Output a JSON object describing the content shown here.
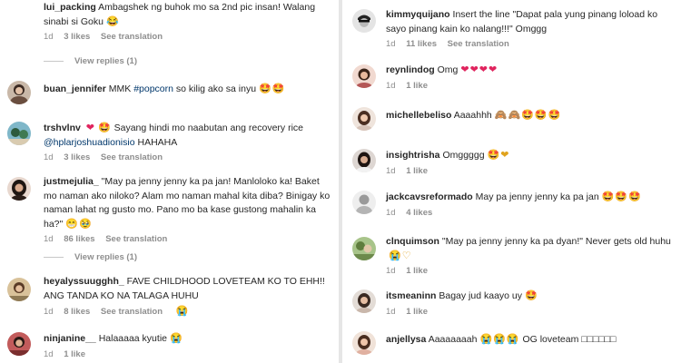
{
  "left": {
    "c1": {
      "username": "lui_packing",
      "text": "Ambagshek ng buhok mo sa 2nd pic insan! Walang sinabi si Goku",
      "emoji": "😂",
      "time": "1d",
      "likes": "3 likes",
      "translate": "See translation",
      "replies": "View replies (1)"
    },
    "c2": {
      "username": "buan_jennifer",
      "text": "MMK ",
      "hashtag": "#popcorn",
      "text2": " so kilig ako sa inyu",
      "emoji": "🤩🤩"
    },
    "c3": {
      "username": "trshvlnv",
      "emoji_lead": "❤",
      "emoji_lead2": "🤩",
      "text": " Sayang hindi mo naabutan ang recovery rice",
      "mention": "@hplarjoshuadionisio",
      "text2": " HAHAHA",
      "time": "1d",
      "likes": "3 likes",
      "translate": "See translation"
    },
    "c4": {
      "username": "justmejulia_",
      "text": "\"May pa jenny jenny ka pa jan! Manloloko ka! Baket mo naman ako niloko? Alam mo naman mahal kita diba? Binigay ko naman lahat ng gusto mo. Pano mo ba kase gustong mahalin ka ha?\"",
      "emoji": "😁🥹",
      "time": "1d",
      "likes": "86 likes",
      "translate": "See translation",
      "replies": "View replies (1)"
    },
    "c5": {
      "username": "heyalyssuugghh_",
      "text": "FAVE CHILDHOOD LOVETEAM KO TO EHH!! ANG TANDA KO NA TALAGA HUHU",
      "time": "1d",
      "likes": "8 likes",
      "translate": "See translation",
      "emoji_after": "😭"
    },
    "c6": {
      "username": "ninjanine__",
      "text": "Halaaaaa kyutie",
      "emoji": "😭",
      "time": "1d",
      "likes": "1 like"
    }
  },
  "right": {
    "c1": {
      "username": "kimmyquijano",
      "text": "Insert the line \"Dapat pala yung pinang loload ko sayo pinang kain ko nalang!!!\" Omggg",
      "time": "1d",
      "likes": "11 likes",
      "translate": "See translation"
    },
    "c2": {
      "username": "reynlindog",
      "text": "Omg",
      "emoji": "❤❤❤❤",
      "time": "1d",
      "likes": "1 like"
    },
    "c3": {
      "username": "michellebeliso",
      "text": "Aaaahhh",
      "emoji": "🙈🙈🤩🤩🤩"
    },
    "c4": {
      "username": "insightrisha",
      "text": "Omggggg",
      "emoji": "🤩❤",
      "time": "1d",
      "likes": "1 like"
    },
    "c5": {
      "username": "jackcavsreformado",
      "text": "May pa jenny jenny ka pa jan",
      "emoji": "🤩🤩🤩",
      "time": "1d",
      "likes": "4 likes"
    },
    "c6": {
      "username": "clnquimson",
      "text": "\"May pa jenny jenny ka pa dyan!\" Never gets old huhu",
      "emoji": "😭♡",
      "time": "1d",
      "likes": "1 like"
    },
    "c7": {
      "username": "itsmeaninn",
      "text": "Bagay jud kaayo uy",
      "emoji": "🤩",
      "time": "1d",
      "likes": "1 like"
    },
    "c8": {
      "username": "anjellysa",
      "text": "Aaaaaaaah",
      "emoji": "😭😭😭",
      "text2": " OG loveteam ",
      "boxes": "□□□□□□"
    }
  },
  "colors": {
    "text": "#262626",
    "meta": "#8e8e8e",
    "link": "#00376b",
    "heart": "#e0245e",
    "divider": "#e6e6e6"
  }
}
